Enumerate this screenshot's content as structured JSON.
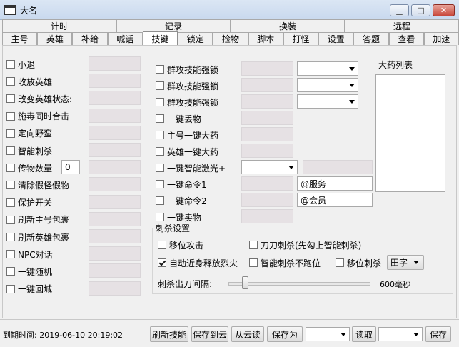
{
  "window": {
    "title": "大名",
    "minimize_glyph": "▁",
    "maximize_glyph": "□",
    "close_glyph": "✕"
  },
  "tabs_row1": [
    "计时",
    "记录",
    "换装",
    "远程"
  ],
  "tabs_row2": [
    "主号",
    "英雄",
    "补给",
    "喊话",
    "技键",
    "锁定",
    "捡物",
    "脚本",
    "打怪",
    "设置",
    "答题",
    "查看",
    "加速"
  ],
  "active_tab": "技键",
  "left_options": [
    "小退",
    "收放英雄",
    "改变英雄状态:",
    "施毒同时合击",
    "定向野蛮",
    "智能刺杀",
    "传物数量",
    "清除假怪假物",
    "保护开关",
    "刷新主号包裹",
    "刷新英雄包裹",
    "NPC对话",
    "一键随机",
    "一键回城"
  ],
  "transfer_count": "0",
  "middle_options": [
    "群攻技能强锁",
    "群攻技能强锁",
    "群攻技能强锁",
    "一键丢物",
    "主号一键大药",
    "英雄一键大药",
    "一键智能激光+",
    "一键命令1",
    "一键命令2",
    "一键卖物"
  ],
  "command1_text": "@服务",
  "command2_text": "@会员",
  "potion_list_label": "大药列表",
  "stab_group": {
    "title": "刺杀设置",
    "opt_move_attack": "移位攻击",
    "opt_blade_stab": "刀刀刺杀(先勾上智能刺杀)",
    "opt_auto_fire": "自动近身释放烈火",
    "opt_no_run": "智能刺杀不跑位",
    "opt_move_stab": "移位刺杀",
    "formation_select": "田字",
    "interval_label": "刺杀出刀间隔:",
    "interval_value": "600毫秒",
    "interval_fraction": 0.12
  },
  "footer": {
    "expiry": "到期时间: 2019-06-10 20:19:02",
    "refresh_skills": "刷新技能",
    "save_cloud": "保存到云",
    "read_cloud": "从云读",
    "save_as": "保存为",
    "read": "读取",
    "save": "保存"
  }
}
